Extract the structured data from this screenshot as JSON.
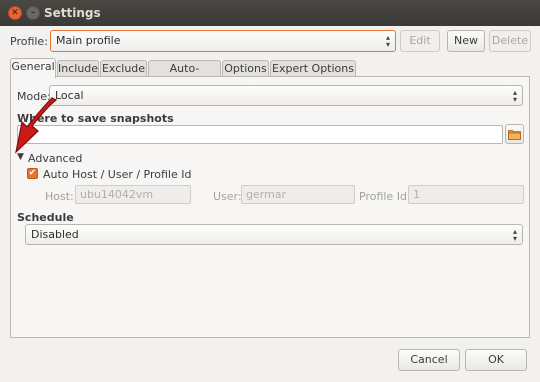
{
  "window": {
    "title": "Settings"
  },
  "profile": {
    "label": "Profile:",
    "selected": "Main profile",
    "edit_label": "Edit",
    "new_label": "New",
    "delete_label": "Delete"
  },
  "tabs": [
    {
      "label": "General"
    },
    {
      "label": "Include"
    },
    {
      "label": "Exclude"
    },
    {
      "label": "Auto-remove"
    },
    {
      "label": "Options"
    },
    {
      "label": "Expert Options"
    }
  ],
  "general": {
    "mode_label": "Mode:",
    "mode_value": "Local",
    "where_label": "Where to save snapshots",
    "where_value": "",
    "advanced_label": "Advanced",
    "auto_host_label": "Auto Host / User / Profile Id",
    "auto_host_checked": true,
    "host_label": "Host:",
    "host_value": "ubu14042vm",
    "user_label": "User:",
    "user_value": "germar",
    "profile_id_label": "Profile Id:",
    "profile_id_value": "1",
    "schedule_label": "Schedule",
    "schedule_value": "Disabled"
  },
  "footer": {
    "cancel_label": "Cancel",
    "ok_label": "OK"
  },
  "annotation": {
    "arrow_color": "#cc1a1a"
  },
  "colors": {
    "accent": "#e8752f",
    "titlebar": "#3f3e3a"
  }
}
